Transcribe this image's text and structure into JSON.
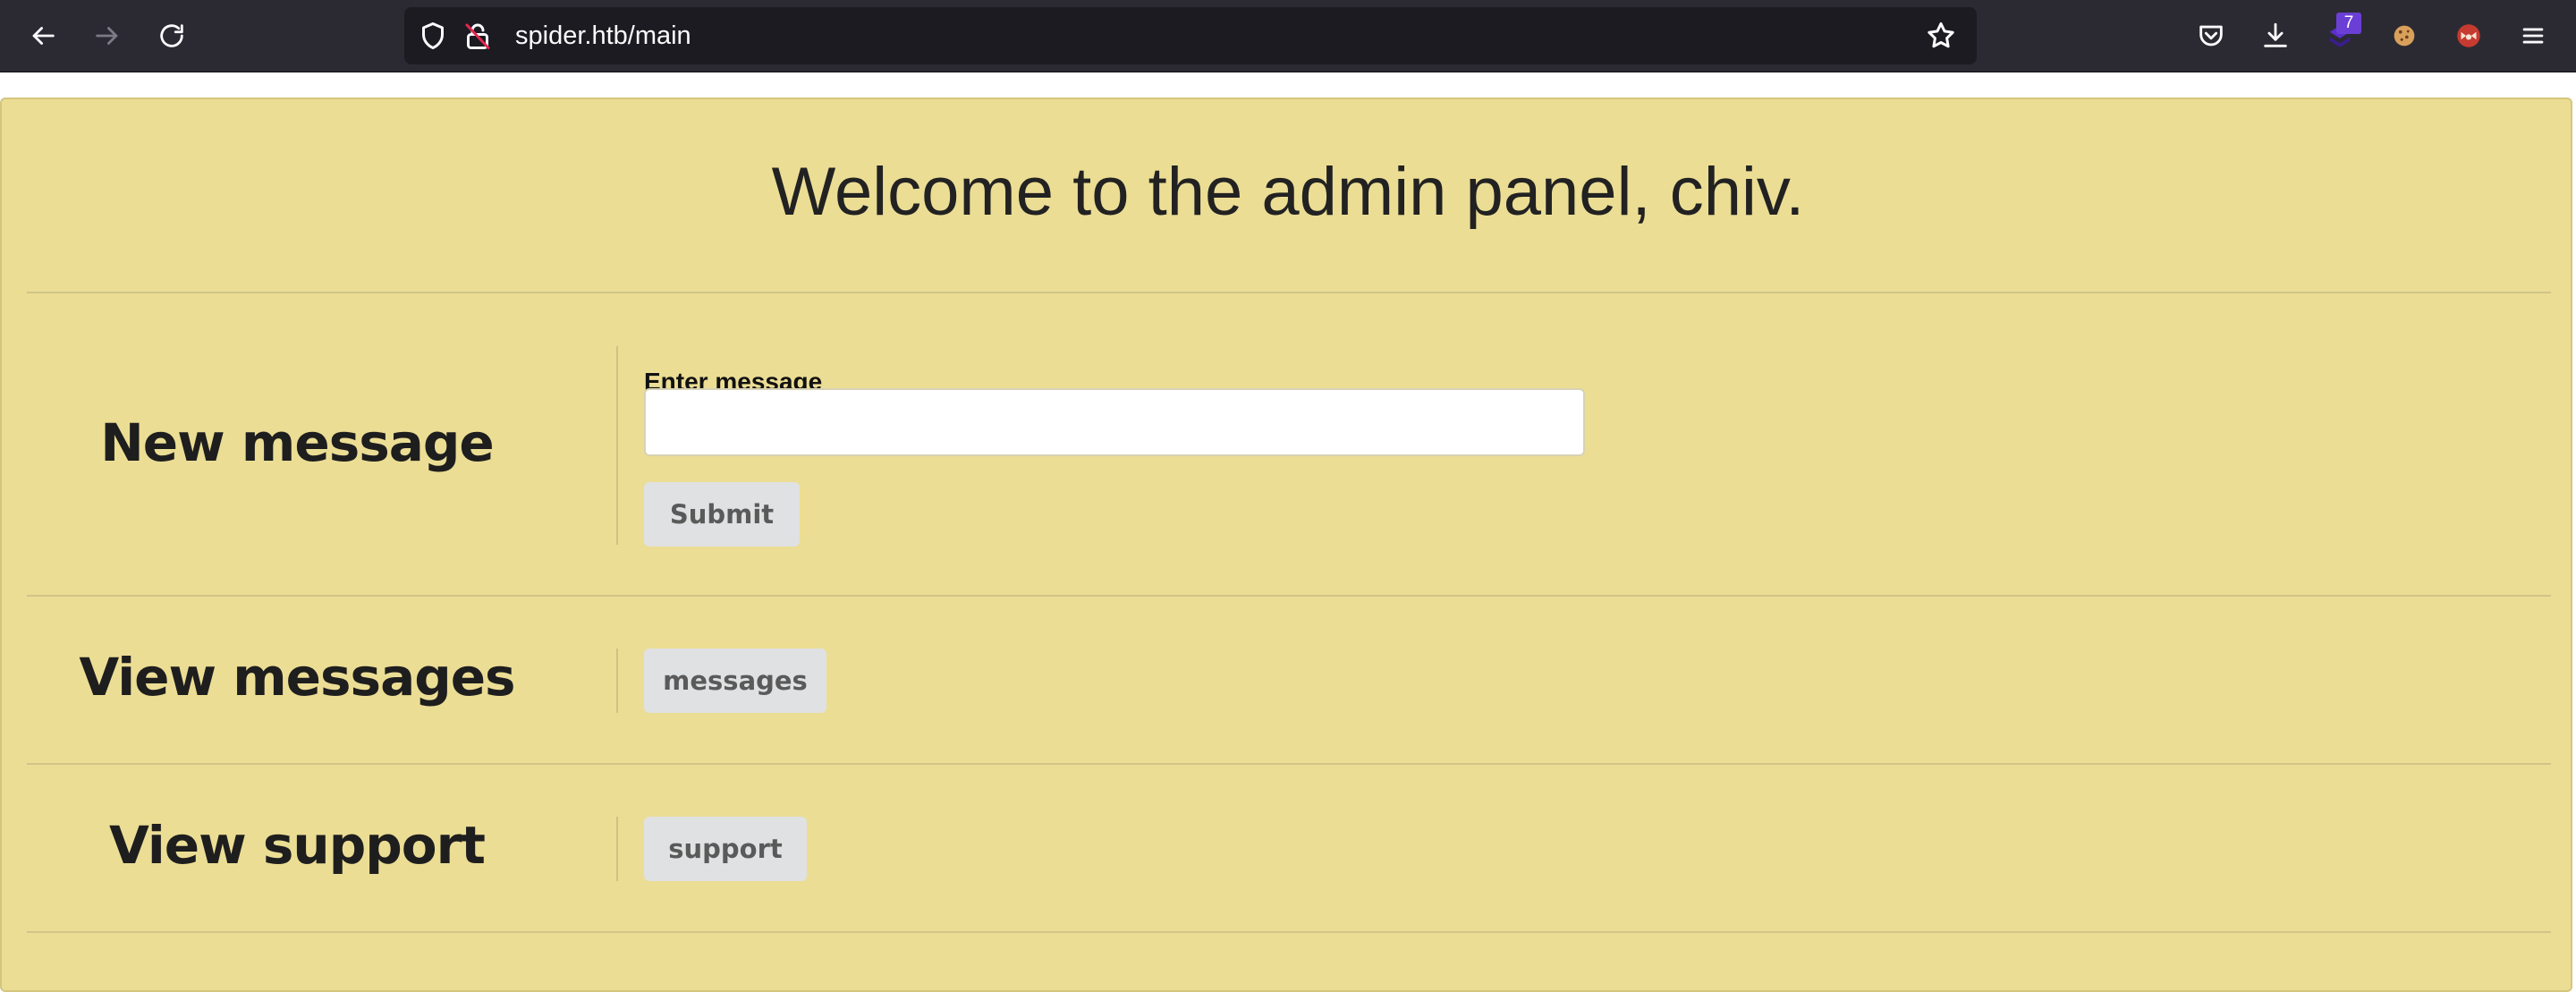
{
  "browser": {
    "url": "spider.htb/main",
    "extension_badge": "7",
    "icons": {
      "back": "back-arrow-icon",
      "forward": "forward-arrow-icon",
      "reload": "reload-icon",
      "tracking": "shield-icon",
      "insecure": "insecure-lock-icon",
      "bookmark": "star-icon",
      "pocket": "pocket-icon",
      "downloads": "download-icon",
      "extension": "extension-icon",
      "cookie": "cookie-icon",
      "foxy": "fox-extension-icon",
      "menu": "hamburger-menu-icon"
    }
  },
  "page": {
    "title": "Welcome to the admin panel, chiv.",
    "new_message": {
      "heading": "New message",
      "field_label": "Enter message",
      "input_value": "",
      "input_placeholder": "",
      "submit_label": "Submit"
    },
    "view_messages": {
      "heading": "View messages",
      "button_label": "messages"
    },
    "view_support": {
      "heading": "View support",
      "button_label": "support"
    }
  },
  "colors": {
    "toolbar_bg": "#2b2a33",
    "urlbar_bg": "#1c1b22",
    "panel_bg": "#ebdd94",
    "button_bg": "#e0e1e2",
    "badge_bg": "#6b3fd6"
  }
}
